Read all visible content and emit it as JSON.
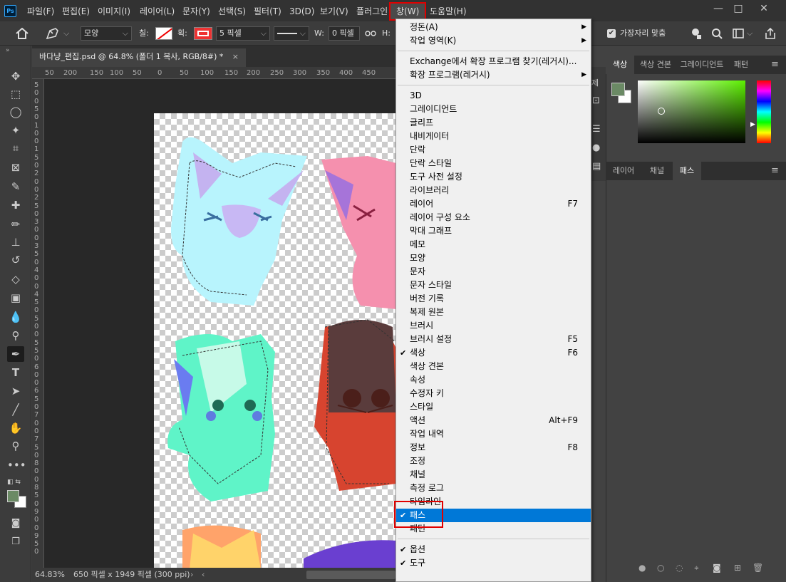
{
  "app": {
    "logo": "Ps"
  },
  "menubar": {
    "items": [
      "파일(F)",
      "편집(E)",
      "이미지(I)",
      "레이어(L)",
      "문자(Y)",
      "선택(S)",
      "필터(T)",
      "3D(D)",
      "보기(V)",
      "플러그인",
      "창(W)",
      "도움말(H)"
    ]
  },
  "window_controls": {
    "minimize": "—",
    "maximize": "□",
    "close": "✕"
  },
  "options": {
    "mode": "모양",
    "fill_label": "칠:",
    "stroke_label": "획:",
    "stroke_width": "5 픽셀",
    "w_label": "W:",
    "w_value": "0 픽셀",
    "h_label": "H:",
    "align_edges": "가장자리 맞춤"
  },
  "document": {
    "tab_title": "바다냥_편집.psd @ 64.8% (폴더 1 복사, RGB/8#) *",
    "close": "×",
    "zoom": "64.83%",
    "size_info": "650 픽셀 x 1949 픽셀 (300 ppi)"
  },
  "ruler": {
    "h_ticks": [
      "50",
      "200",
      "150",
      "100",
      "50",
      "0",
      "50",
      "100",
      "150",
      "200",
      "250",
      "300",
      "350",
      "400",
      "450"
    ],
    "v_ticks": [
      "5",
      "0",
      "0",
      "5",
      "0",
      "1",
      "0",
      "0",
      "1",
      "5",
      "0",
      "2",
      "0",
      "0",
      "2",
      "5",
      "0",
      "3",
      "0",
      "0",
      "3",
      "5",
      "0",
      "4",
      "0",
      "0",
      "4",
      "5",
      "0",
      "5",
      "0",
      "0",
      "5",
      "5",
      "0",
      "6",
      "0",
      "0",
      "6",
      "5",
      "0",
      "7",
      "0",
      "0",
      "7",
      "5",
      "0",
      "8",
      "0",
      "0",
      "8",
      "5",
      "0",
      "9",
      "0",
      "0",
      "9",
      "5",
      "0"
    ]
  },
  "right_panel": {
    "color_tabs": [
      "색상",
      "색상 견본",
      "그레이디언트",
      "패턴"
    ],
    "layer_tabs": [
      "레이어",
      "채널",
      "패스"
    ],
    "strip_glyph": "제"
  },
  "colors": {
    "foreground": "#6b8a65",
    "background": "#ffffff",
    "accent": "#0078d7",
    "highlight_box": "#e00000"
  },
  "window_menu": {
    "groups": [
      [
        {
          "label": "정돈(A)",
          "submenu": true
        },
        {
          "label": "작업 영역(K)",
          "submenu": true
        }
      ],
      [
        {
          "label": "Exchange에서 확장 프로그램 찾기(레거시)..."
        },
        {
          "label": "확장 프로그램(레거시)",
          "submenu": true
        }
      ],
      [
        {
          "label": "3D"
        },
        {
          "label": "그레이디언트"
        },
        {
          "label": "글리프"
        },
        {
          "label": "내비게이터"
        },
        {
          "label": "단락"
        },
        {
          "label": "단락 스타일"
        },
        {
          "label": "도구 사전 설정"
        },
        {
          "label": "라이브러리"
        },
        {
          "label": "레이어",
          "shortcut": "F7"
        },
        {
          "label": "레이어 구성 요소"
        },
        {
          "label": "막대 그래프"
        },
        {
          "label": "메모"
        },
        {
          "label": "모양"
        },
        {
          "label": "문자"
        },
        {
          "label": "문자 스타일"
        },
        {
          "label": "버전 기록"
        },
        {
          "label": "복제 원본"
        },
        {
          "label": "브러시"
        },
        {
          "label": "브러시 설정",
          "shortcut": "F5"
        },
        {
          "label": "색상",
          "shortcut": "F6",
          "checked": true
        },
        {
          "label": "색상 견본"
        },
        {
          "label": "속성"
        },
        {
          "label": "수정자 키"
        },
        {
          "label": "스타일"
        },
        {
          "label": "액션",
          "shortcut": "Alt+F9"
        },
        {
          "label": "작업 내역"
        },
        {
          "label": "정보",
          "shortcut": "F8"
        },
        {
          "label": "조정"
        },
        {
          "label": "채널"
        },
        {
          "label": "측정 로그"
        },
        {
          "label": "타임라인"
        },
        {
          "label": "패스",
          "checked": true,
          "highlighted": true
        },
        {
          "label": "패턴"
        }
      ],
      [
        {
          "label": "옵션",
          "checked": true
        },
        {
          "label": "도구",
          "checked": true
        }
      ]
    ]
  },
  "icons": [
    "home-icon",
    "pen-tool-icon",
    "move-icon",
    "marquee-icon",
    "lasso-icon",
    "magic-wand-icon",
    "crop-icon",
    "frame-icon",
    "eyedropper-icon",
    "healing-brush-icon",
    "brush-icon",
    "clone-stamp-icon",
    "history-brush-icon",
    "eraser-icon",
    "gradient-icon",
    "blur-icon",
    "dodge-icon",
    "pen-icon",
    "type-icon",
    "path-selection-icon",
    "line-icon",
    "hand-icon",
    "zoom-icon",
    "more-tools-icon"
  ]
}
